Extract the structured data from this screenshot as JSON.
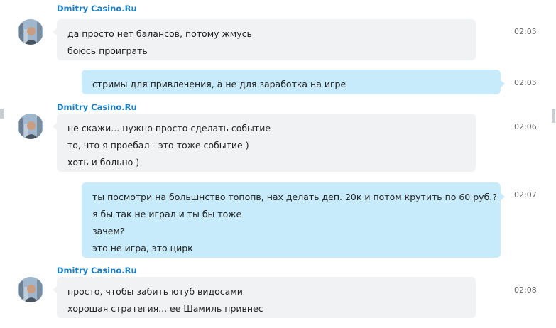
{
  "chat": {
    "messages": [
      {
        "direction": "in",
        "sender": "Dmitry Casino.Ru",
        "time": "02:05",
        "lines": [
          "да просто нет балансов, потому жмусь",
          "боюсь проиграть"
        ]
      },
      {
        "direction": "out",
        "time": "02:05",
        "lines": [
          "стримы для привлечения, а не для заработка на игре"
        ]
      },
      {
        "direction": "in",
        "sender": "Dmitry Casino.Ru",
        "time": "02:06",
        "lines": [
          "не скажи... нужно просто сделать событие",
          "то, что я проебал - это тоже событие )",
          "хоть и больно )"
        ]
      },
      {
        "direction": "out",
        "time": "02:07",
        "lines": [
          "ты посмотри на большнство топопв, нах делать деп. 20к и потом крутить по 60 руб.?",
          "я бы так не играл и ты бы тоже",
          "зачем?",
          "это не игра, это цирк"
        ]
      },
      {
        "direction": "in",
        "sender": "Dmitry Casino.Ru",
        "time": "02:08",
        "lines": [
          "просто, чтобы забить ютуб видосами",
          "хорошая стратегия... ее Шамиль привнес"
        ]
      }
    ]
  },
  "colors": {
    "sender_name": "#1c7ec0",
    "incoming_bubble": "#f1f2f4",
    "outgoing_bubble": "#c7ebfb"
  }
}
